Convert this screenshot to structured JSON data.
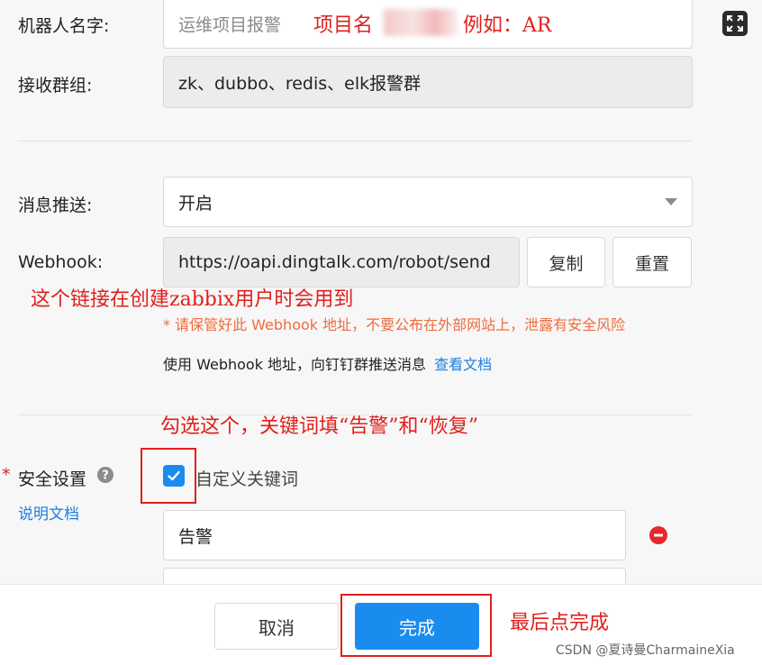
{
  "form": {
    "robot_name_label": "机器人名字:",
    "robot_name_placeholder": "运维项目报警",
    "group_label": "接收群组:",
    "group_value": "zk、dubbo、redis、elk报警群",
    "push_label": "消息推送:",
    "push_value": "开启",
    "webhook_label": "Webhook:",
    "webhook_value": "https://oapi.dingtalk.com/robot/send",
    "copy_label": "复制",
    "reset_label": "重置",
    "webhook_warning": "* 请保管好此 Webhook 地址，不要公布在外部网站上，泄露有安全风险",
    "webhook_usage": "使用 Webhook 地址，向钉钉群推送消息",
    "doc_link": "查看文档",
    "security_required_mark": "*",
    "security_label": "安全设置",
    "security_doc_link": "说明文档",
    "keyword_checkbox_label": "自定义关键词",
    "keyword_checked": true,
    "keyword_value": "告警",
    "keyword_value_2": ""
  },
  "footer": {
    "cancel_label": "取消",
    "done_label": "完成"
  },
  "annotations": {
    "project_name": "项目名",
    "project_example": "例如：AR",
    "link_note": "这个链接在创建zabbix用户时会用到",
    "check_note": "勾选这个，关键词填“告警”和“恢复”",
    "finish_note": "最后点完成"
  },
  "watermark": "CSDN @夏诗曼CharmaineXia",
  "colors": {
    "primary": "#1a8cf0",
    "annotation_red": "#e0201c",
    "warning_orange": "#ef6b3c",
    "link_blue": "#1a7fe0",
    "remove_red": "#e8262b"
  }
}
